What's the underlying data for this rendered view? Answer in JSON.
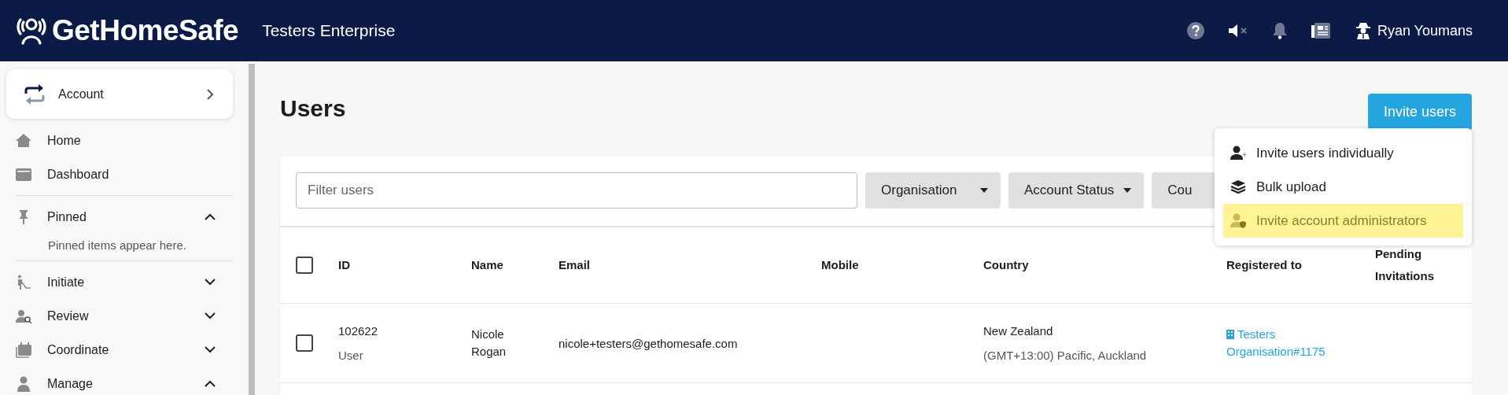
{
  "header": {
    "logo": "GetHomeSafe",
    "org": "Testers Enterprise",
    "user": "Ryan Youmans"
  },
  "sidebar": {
    "account": "Account",
    "items": [
      {
        "kind": "link",
        "label": "Home"
      },
      {
        "kind": "link",
        "label": "Dashboard"
      },
      {
        "kind": "divider"
      },
      {
        "kind": "group",
        "label": "Pinned",
        "expanded": true,
        "note": "Pinned items appear here."
      },
      {
        "kind": "divider"
      },
      {
        "kind": "group",
        "label": "Initiate",
        "expanded": false
      },
      {
        "kind": "group",
        "label": "Review",
        "expanded": false
      },
      {
        "kind": "group",
        "label": "Coordinate",
        "expanded": false
      },
      {
        "kind": "group",
        "label": "Manage",
        "expanded": true
      }
    ]
  },
  "page": {
    "title": "Users",
    "invite_button": "Invite users",
    "invite_menu": [
      {
        "label": "Invite users individually",
        "selected": false
      },
      {
        "label": "Bulk upload",
        "selected": false
      },
      {
        "label": "Invite account administrators",
        "selected": true
      }
    ],
    "filter": {
      "placeholder": "Filter users"
    },
    "filters": [
      {
        "label": "Organisation"
      },
      {
        "label": "Account Status"
      },
      {
        "label": "Cou"
      }
    ],
    "table": {
      "header_checked": false,
      "columns": [
        "ID",
        "Name",
        "Email",
        "Mobile",
        "Country",
        "Registered to",
        "Pending Invitations"
      ],
      "rows": [
        {
          "checked": false,
          "id": "102622",
          "role": "User",
          "name": "Nicole Rogan",
          "email": "nicole+testers@gethomesafe.com",
          "country": "New Zealand",
          "timezone": "(GMT+13:00) Pacific, Auckland",
          "registered_to": "Testers Organisation#1175"
        }
      ]
    }
  }
}
